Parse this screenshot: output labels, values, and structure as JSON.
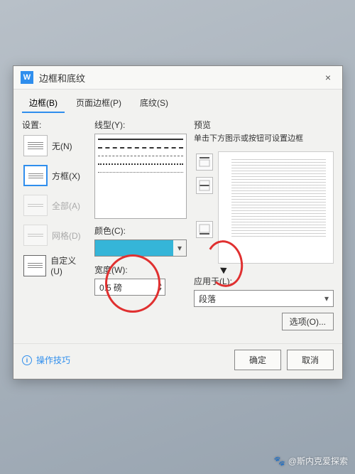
{
  "dialog": {
    "title": "边框和底纹",
    "close": "×"
  },
  "tabs": {
    "border": "边框(B)",
    "page_border": "页面边框(P)",
    "shading": "底纹(S)"
  },
  "settings": {
    "label": "设置:",
    "none": "无(N)",
    "box": "方框(X)",
    "all": "全部(A)",
    "grid": "网格(D)",
    "custom": "自定义(U)"
  },
  "line": {
    "label": "线型(Y):"
  },
  "color": {
    "label": "颜色(C):",
    "value": "#35b5d8"
  },
  "width": {
    "label": "宽度(W):",
    "value": "0.5",
    "unit": "磅"
  },
  "preview": {
    "label": "预览",
    "desc": "单击下方图示或按钮可设置边框"
  },
  "apply": {
    "label": "应用于(L):",
    "value": "段落"
  },
  "options_btn": "选项(O)...",
  "tips": "操作技巧",
  "ok": "确定",
  "cancel": "取消",
  "watermark": "@斯内克爱探索"
}
